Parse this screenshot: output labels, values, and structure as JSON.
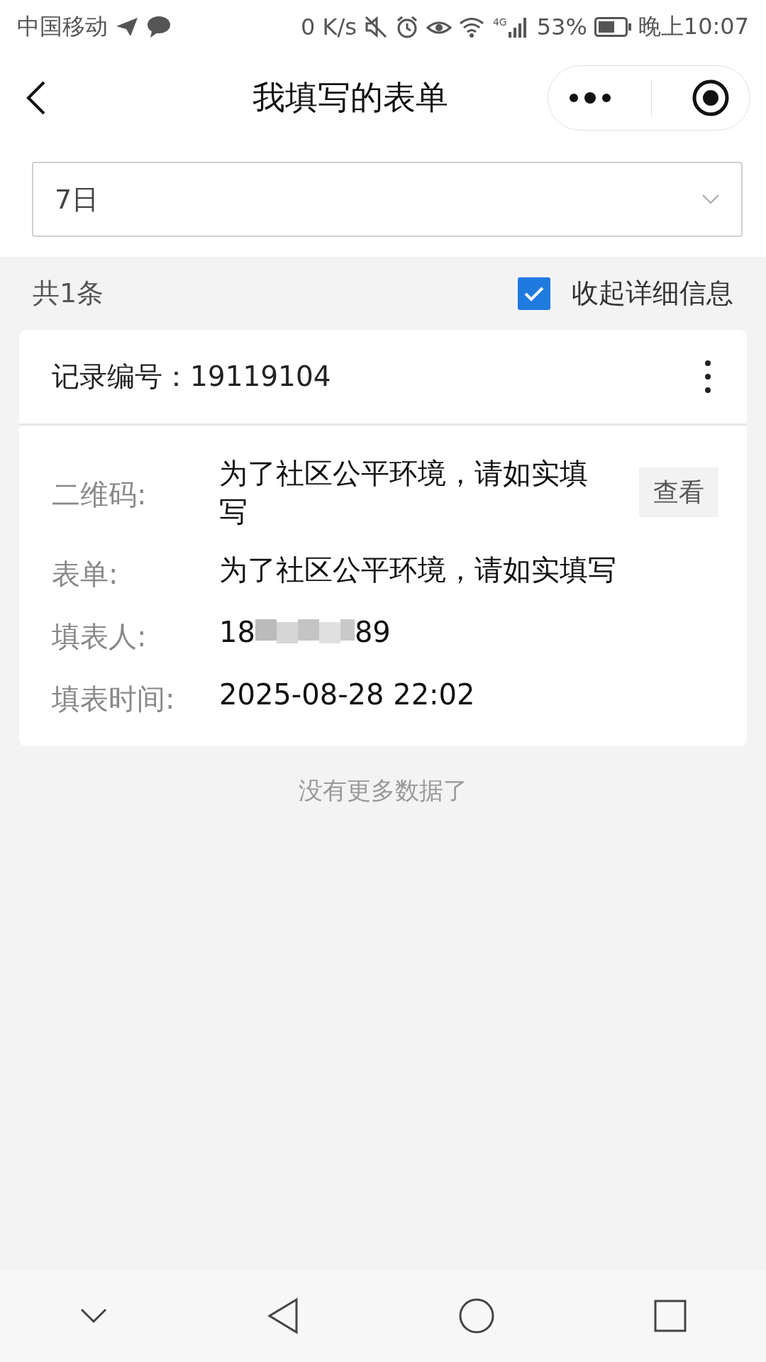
{
  "status_bar": {
    "carrier": "中国移动",
    "speed": "0 K/s",
    "network": "4G",
    "battery": "53%",
    "time": "晚上10:07"
  },
  "nav": {
    "title": "我填写的表单"
  },
  "filter": {
    "value": "7日"
  },
  "summary": {
    "count": "共1条",
    "collapse_label": "收起详细信息",
    "collapse_checked": true
  },
  "record": {
    "title": "记录编号：19119104",
    "fields": [
      {
        "kind": "action",
        "label": "二维码:",
        "value": "为了社区公平环境，请如实填写",
        "button": "查看"
      },
      {
        "kind": "text",
        "label": "表单:",
        "value": "为了社区公平环境，请如实填写"
      },
      {
        "kind": "masked",
        "label": "填表人:",
        "value_start": "18",
        "value_end": "89"
      },
      {
        "kind": "text",
        "label": "填表时间:",
        "value": "2025-08-28 22:02"
      }
    ]
  },
  "footer": "没有更多数据了"
}
